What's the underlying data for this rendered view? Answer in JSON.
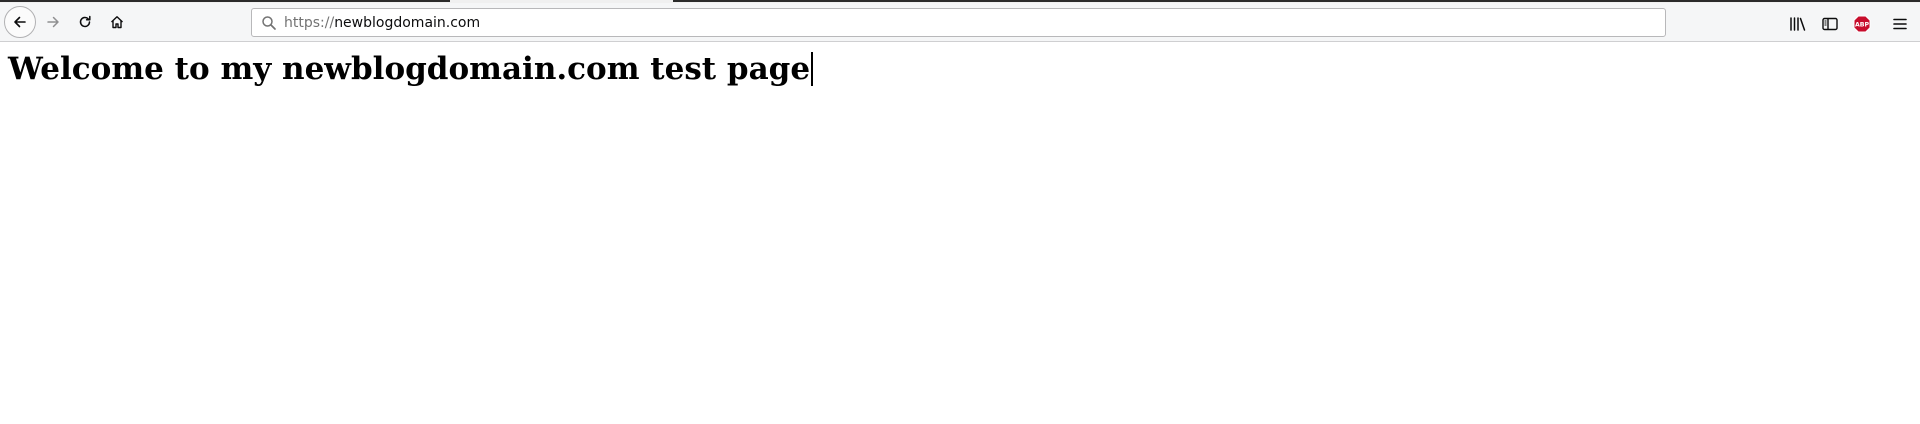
{
  "browser": {
    "url_scheme": "https://",
    "url_host": "newblogdomain.com",
    "icons": {
      "back": "arrow-left-icon",
      "forward": "arrow-right-icon",
      "reload": "reload-icon",
      "home": "home-icon",
      "search": "search-icon",
      "library": "library-icon",
      "sidebar": "sidebar-icon",
      "adblock": "adblock-plus-icon",
      "menu": "hamburger-menu-icon"
    },
    "adblock_badge": "ABP",
    "adblock_color": "#c70d2c"
  },
  "page": {
    "heading": "Welcome to my newblogdomain.com test page"
  }
}
